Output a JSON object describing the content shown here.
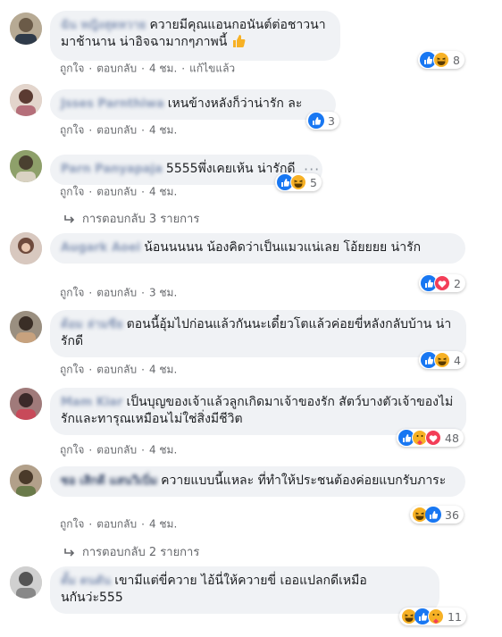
{
  "labels": {
    "like": "ถูกใจ",
    "reply": "ตอบกลับ",
    "sep": "·"
  },
  "comments": [
    {
      "name": "ฉัน หญิงสุดหวาย",
      "text": "ควายมีคุณแอนกอนันต์ต่อชาวนามาช้านาน น่าอิจฉามากๆภาพนี้",
      "time": "4 ชม.",
      "edited": "แก้ไขแล้ว",
      "reactions": [
        "like",
        "haha"
      ],
      "count": "8"
    },
    {
      "name": "Jsses Parnthiwa",
      "text": "เหนข้างหลังก็ว่าน่ารัก ละ",
      "time": "4 ชม.",
      "reactions": [
        "like"
      ],
      "count": "3"
    },
    {
      "name": "Parn Panyapaja",
      "text": "5555พึ่งเคยเห้น น่ารักดี",
      "time": "4 ชม.",
      "reactions": [
        "like",
        "haha"
      ],
      "count": "5"
    },
    {
      "name": "Augark Aoei",
      "text": "น้อนนนนน น้องคิดว่าเป็นแมวแน่เลย โอ้ยยยย น่ารัก",
      "time": "3 ชม.",
      "reactions": [
        "like",
        "love"
      ],
      "count": "2"
    },
    {
      "name": "ต้อม ล่ามชีย",
      "text": "ตอนนี้อุ้มไปก่อนแล้วกันนะเดี๋ยวโตแล้วค่อยขี่หลังกลับบ้าน น่ารักดี",
      "time": "4 ชม.",
      "reactions": [
        "like",
        "haha"
      ],
      "count": "4"
    },
    {
      "name": "Mam Kiar",
      "text": "เป็นบุญของเจ้าแล้วลูกเกิดมาเจ้าของรัก สัตว์บางตัวเจ้าของไม่รักและทารุณเหมือนไม่ใช่สิ่งมีชีวิต",
      "time": "4 ชม.",
      "reactions": [
        "like",
        "care",
        "love"
      ],
      "count": "48"
    },
    {
      "name": "ซอ เสิกดี แสนวิเบิ่ม",
      "text": "ควายแบบนี้แหละ ที่ทำให้ประชนต้องค่อยแบกรับภาระ",
      "time": "4 ชม.",
      "reactions": [
        "haha",
        "like"
      ],
      "count": "36"
    },
    {
      "name": "ตั้ม ตนตัน",
      "text": "เขามีแต่ขี่ควาย ไอ้นี่ให้ควายขี่ เออแปลกดีเหมือนกันว่ะ555",
      "time": "4 ชม.",
      "reactions": [
        "haha",
        "like",
        "care"
      ],
      "count": "11"
    }
  ],
  "replies": [
    "การตอบกลับ 3 รายการ",
    "การตอบกลับ 2 รายการ"
  ],
  "more_dots": "···",
  "colors": {
    "like": "#1877f2",
    "love": "#f33e58",
    "haha": "#f7b125",
    "meta": "#65676b",
    "bubble": "#f0f2f5"
  }
}
